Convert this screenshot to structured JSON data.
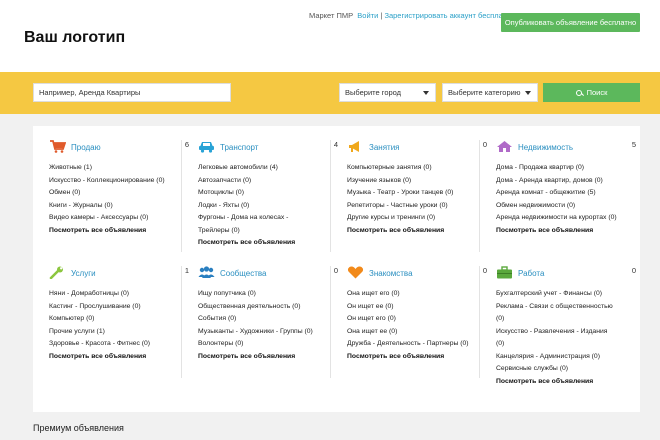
{
  "header": {
    "logo": "Ваш логотип",
    "market_label": "Маркет ПМР",
    "login_link": "Войти",
    "or_text": "|",
    "register_link": "Зарегистрировать аккаунт бесплатно",
    "post_button": "Опубликовать объявление бесплатно"
  },
  "search": {
    "placeholder": "Например, Аренда Квартиры",
    "city_select": "Выберите город",
    "category_select": "Выберите категорию",
    "search_button": "Поиск"
  },
  "colors": {
    "accent_green": "#5cb85c",
    "search_bar_yellow": "#f5c842",
    "link_blue": "#2a8fc0"
  },
  "categories": [
    {
      "title": "Продаю",
      "count": "6",
      "icon": "cart-icon",
      "items": [
        "Животные (1)",
        "Искусство - Коллекционирование (0)",
        "Обмен (0)",
        "Книги - Журналы (0)",
        "Видео камеры - Аксессуары (0)"
      ],
      "all": "Посмотреть все объявления"
    },
    {
      "title": "Транспорт",
      "count": "4",
      "icon": "car-icon",
      "items": [
        "Легковые автомобили (4)",
        "Автозапчасти (0)",
        "Мотоциклы (0)",
        "Лодки - Яхты (0)",
        "Фургоны - Дома на колесах -",
        "Трейлеры (0)"
      ],
      "all": "Посмотреть все объявления"
    },
    {
      "title": "Занятия",
      "count": "0",
      "icon": "megaphone-icon",
      "items": [
        "Компьютерные занятия (0)",
        "Изучение языков (0)",
        "Музыка - Театр - Уроки танцев (0)",
        "Репетиторы - Частные уроки (0)",
        "Другие курсы и тренинги (0)"
      ],
      "all": "Посмотреть все объявления"
    },
    {
      "title": "Недвижимость",
      "count": "5",
      "icon": "house-icon",
      "items": [
        "Дома - Продажа квартир (0)",
        "Дома - Аренда квартир, домов (0)",
        "Аренда комнат - общежитие (5)",
        "Обмен недвижимости (0)",
        "Аренда недвижимости на курортах (0)"
      ],
      "all": "Посмотреть все объявления"
    },
    {
      "title": "Услуги",
      "count": "1",
      "icon": "wrench-icon",
      "items": [
        "Няни - Домработницы (0)",
        "Кастинг - Прослушивание (0)",
        "Компьютер (0)",
        "Прочие услуги (1)",
        "Здоровье - Красота - Фитнес (0)"
      ],
      "all": "Посмотреть все объявления"
    },
    {
      "title": "Сообщества",
      "count": "0",
      "icon": "people-icon",
      "items": [
        "Ищу попутчика (0)",
        "Общественная деятельность (0)",
        "События (0)",
        "Музыканты - Художники - Группы (0)",
        "Волонтеры (0)"
      ],
      "all": "Посмотреть все объявления"
    },
    {
      "title": "Знакомства",
      "count": "0",
      "icon": "heart-icon",
      "items": [
        "Она ищет его (0)",
        "Он ищет ее (0)",
        "Он ищет его (0)",
        "Она ищет ее (0)",
        "Дружба - Деятельность - Партнеры (0)"
      ],
      "all": "Посмотреть все объявления"
    },
    {
      "title": "Работа",
      "count": "0",
      "icon": "briefcase-icon",
      "items": [
        "Бухгалтерский учет - Финансы (0)",
        "Реклама - Связи с общественностью",
        "(0)",
        "Искусство - Развлечения - Издания",
        "(0)",
        "Канцелярия - Администрация (0)",
        "Сервисные службы (0)"
      ],
      "all": "Посмотреть все объявления"
    }
  ],
  "premium": {
    "title": "Премиум объявления"
  }
}
